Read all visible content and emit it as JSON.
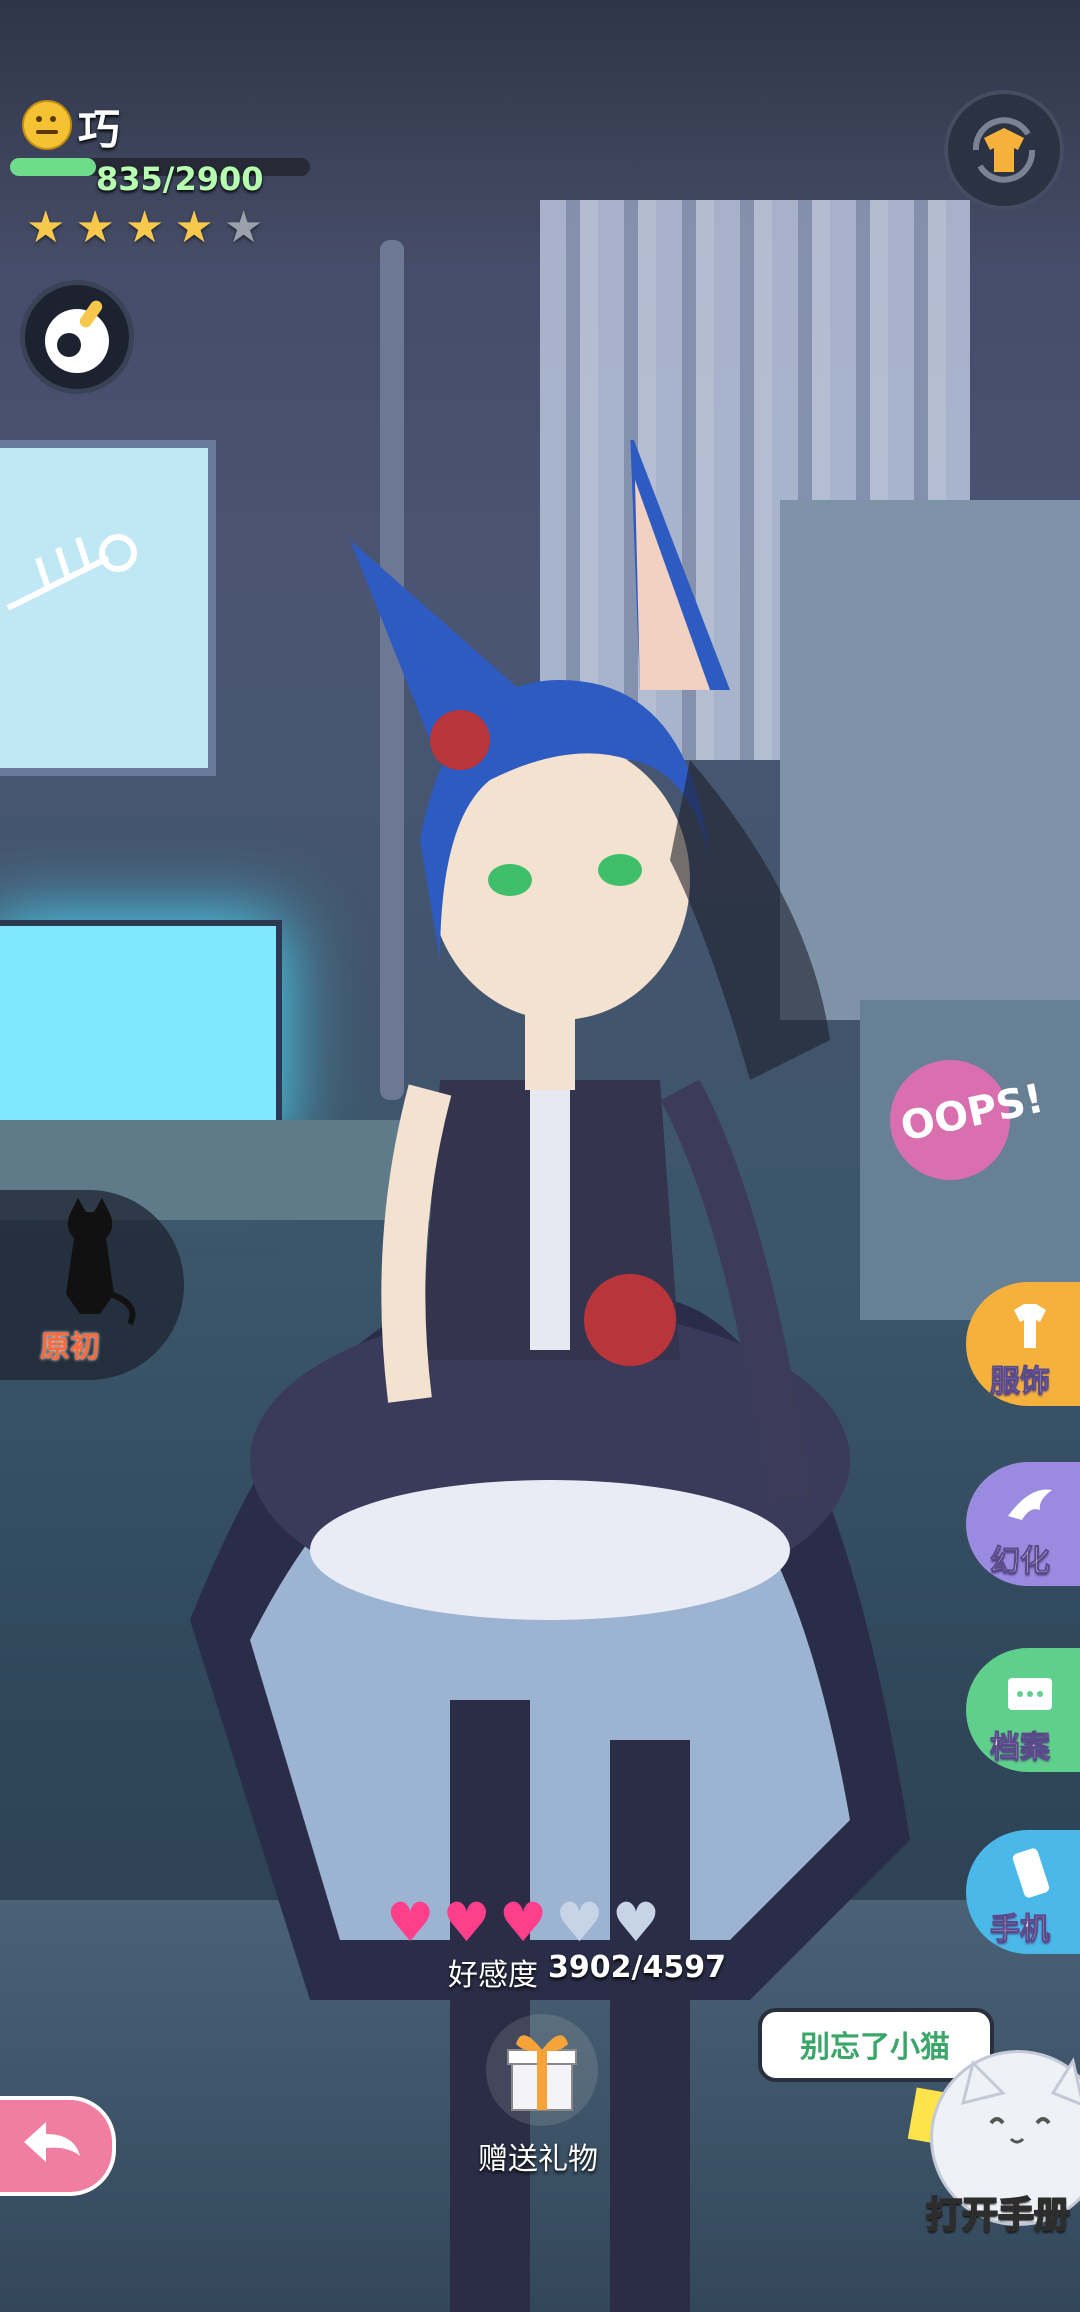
{
  "hud": {
    "name": "巧",
    "xp_text": "835/2900",
    "xp_fraction": 0.288,
    "stars_filled": 4,
    "stars_total": 5
  },
  "outfit_badge": {
    "label": "原初"
  },
  "side_menu": [
    {
      "label": "服饰",
      "icon": "clothes-icon",
      "color": "#f6b13d"
    },
    {
      "label": "幻化",
      "icon": "bird-icon",
      "color": "#9b8be0"
    },
    {
      "label": "档案",
      "icon": "folder-icon",
      "color": "#5fd08b"
    },
    {
      "label": "手机",
      "icon": "phone-icon",
      "color": "#4ab8e8"
    }
  ],
  "affection": {
    "label": "好感度",
    "value": "3902/4597",
    "hearts_filled": 3,
    "hearts_total": 5
  },
  "gift": {
    "label": "赠送礼物"
  },
  "speech_bubble": {
    "text": "别忘了小猫"
  },
  "handbook": {
    "label": "打开手册"
  },
  "scene_decor": {
    "sign_text": "OOPS!"
  },
  "colors": {
    "star_on": "#f6c84c",
    "heart_on": "#ff3f8a",
    "xp_bar": "#6fdc8c",
    "back_button": "#f07ea2"
  }
}
